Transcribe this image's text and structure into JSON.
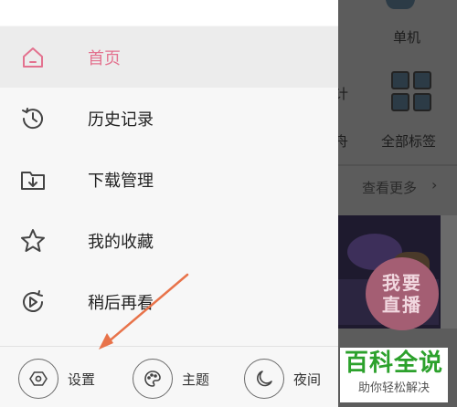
{
  "background": {
    "single_label": "单机",
    "partial_text_1": "计",
    "partial_text_2": "舟",
    "all_tags_label": "全部标签",
    "see_more": "查看更多",
    "live_button": [
      "我要",
      "直播"
    ]
  },
  "drawer": {
    "menu": [
      {
        "label": "首页",
        "icon": "home-icon",
        "active": true
      },
      {
        "label": "历史记录",
        "icon": "history-icon",
        "active": false
      },
      {
        "label": "下载管理",
        "icon": "download-folder-icon",
        "active": false
      },
      {
        "label": "我的收藏",
        "icon": "star-icon",
        "active": false
      },
      {
        "label": "稍后再看",
        "icon": "watch-later-icon",
        "active": false
      }
    ],
    "bottom": [
      {
        "label": "设置",
        "icon": "settings-icon"
      },
      {
        "label": "主题",
        "icon": "theme-palette-icon"
      },
      {
        "label": "夜间",
        "icon": "night-moon-icon"
      }
    ]
  },
  "watermark": {
    "title": "百科全说",
    "subtitle": "助你轻松解决"
  },
  "colors": {
    "accent": "#e3728f",
    "arrow": "#e8734a",
    "watermark_green": "#2ca12c"
  }
}
